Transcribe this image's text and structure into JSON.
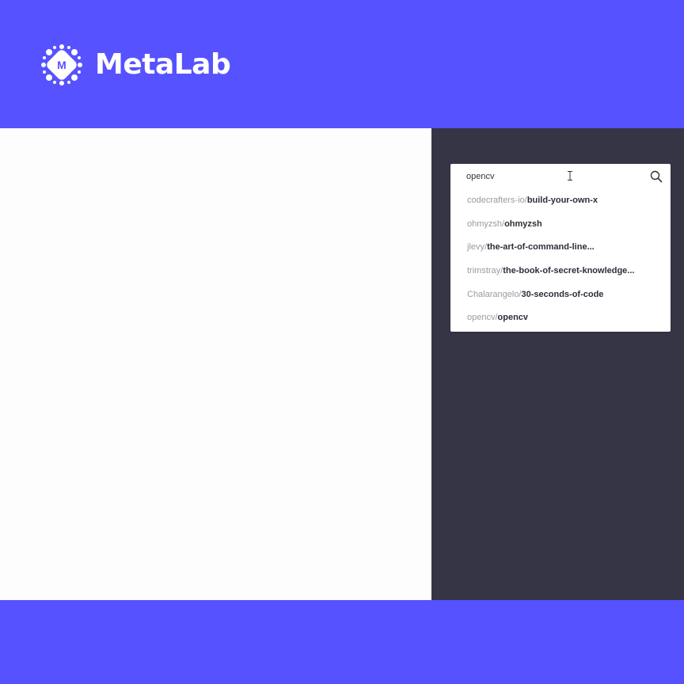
{
  "brand": {
    "name": "MetaLab",
    "mark_letter": "M"
  },
  "search": {
    "value": "opencv",
    "placeholder": ""
  },
  "results": [
    {
      "owner": "codecrafters-io/",
      "repo": "build-your-own-x"
    },
    {
      "owner": "ohmyzsh/",
      "repo": "ohmyzsh"
    },
    {
      "owner": "jlevy/",
      "repo": "the-art-of-command-line..."
    },
    {
      "owner": "trimstray/",
      "repo": "the-book-of-secret-knowledge..."
    },
    {
      "owner": "Chalarangelo/",
      "repo": "30-seconds-of-code"
    },
    {
      "owner": "opencv/",
      "repo": "opencv"
    }
  ],
  "colors": {
    "brand_purple": "#5752ff",
    "sidebar_dark": "#353546",
    "canvas_white": "#fdfdfd"
  },
  "icons": {
    "search": "search-icon",
    "cursor": "text-cursor-icon",
    "logo": "metalab-logo-icon"
  }
}
